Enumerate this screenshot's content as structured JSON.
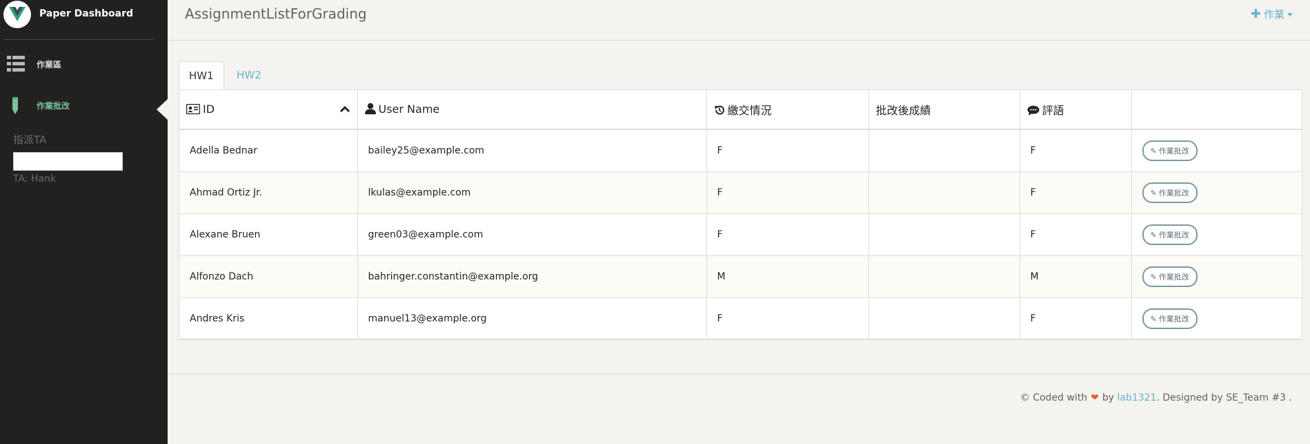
{
  "sidebar": {
    "brand_title": "Paper Dashboard",
    "items": [
      {
        "label": "作業區",
        "icon": "list-icon"
      },
      {
        "label": "作業批改",
        "icon": "pencil-icon"
      }
    ],
    "assign_ta_label": "指派TA",
    "assign_ta_value": "",
    "ta_label": "TA: Hank"
  },
  "header": {
    "title": "AssignmentListForGrading",
    "action_label": "作業"
  },
  "tabs": [
    {
      "label": "HW1",
      "active": true
    },
    {
      "label": "HW2",
      "active": false
    }
  ],
  "table": {
    "headers": [
      "ID",
      "User Name",
      "繳交情況",
      "批改後成績",
      "評語",
      ""
    ],
    "rows": [
      {
        "id": "Adella Bednar",
        "username": "bailey25@example.com",
        "status": "F",
        "score": "",
        "comment": "F",
        "button": "作業批改"
      },
      {
        "id": "Ahmad Ortiz Jr.",
        "username": "lkulas@example.com",
        "status": "F",
        "score": "",
        "comment": "F",
        "button": "作業批改"
      },
      {
        "id": "Alexane Bruen",
        "username": "green03@example.com",
        "status": "F",
        "score": "",
        "comment": "F",
        "button": "作業批改"
      },
      {
        "id": "Alfonzo Dach",
        "username": "bahringer.constantin@example.org",
        "status": "M",
        "score": "",
        "comment": "M",
        "button": "作業批改"
      },
      {
        "id": "Andres Kris",
        "username": "manuel13@example.org",
        "status": "F",
        "score": "",
        "comment": "F",
        "button": "作業批改"
      }
    ]
  },
  "footer": {
    "prefix": "© Coded with",
    "by": "by",
    "author": "lab1321",
    "suffix": ". Designed by SE_Team #3 ."
  },
  "colors": {
    "sidebar_bg": "#212120",
    "accent_green": "#7ac29a",
    "accent_blue": "#68b3c8",
    "heart": "#eb5e28",
    "page_bg": "#f4f3ef"
  }
}
